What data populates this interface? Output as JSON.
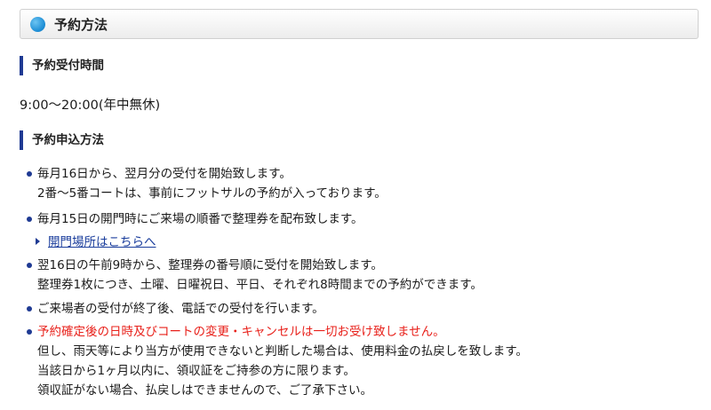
{
  "section": {
    "title": "予約方法",
    "icon": "blue-circle-icon"
  },
  "reception": {
    "heading": "予約受付時間",
    "hours": "9:00〜20:00(年中無休)"
  },
  "application": {
    "heading": "予約申込方法",
    "items": [
      {
        "lines": [
          "毎月16日から、翌月分の受付を開始致します。",
          "2番〜5番コートは、事前にフットサルの予約が入っております。"
        ]
      },
      {
        "lines": [
          "毎月15日の開門時にご来場の順番で整理券を配布致します。"
        ]
      },
      {
        "lines": [
          "翌16日の午前9時から、整理券の番号順に受付を開始致します。",
          "整理券1枚につき、土曜、日曜祝日、平日、それぞれ8時間までの予約ができます。"
        ]
      },
      {
        "lines": [
          "ご来場者の受付が終了後、電話での受付を行います。"
        ]
      },
      {
        "lines": [
          "予約確定後の日時及びコートの変更・キャンセルは一切お受け致しません。",
          "但し、雨天等により当方が使用できないと判断した場合は、使用料金の払戻しを致します。",
          "当該日から1ヶ月以内に、領収証をご持参の方に限ります。",
          "領収証がない場合、払戻しはできませんので、ご了承下さい。"
        ]
      }
    ],
    "link": {
      "label": "開門場所はこちらへ"
    }
  },
  "colors": {
    "accent": "#1f3a93",
    "warning": "#e8201a",
    "link": "#1a3d9c",
    "icon": "#1f8fd6"
  }
}
